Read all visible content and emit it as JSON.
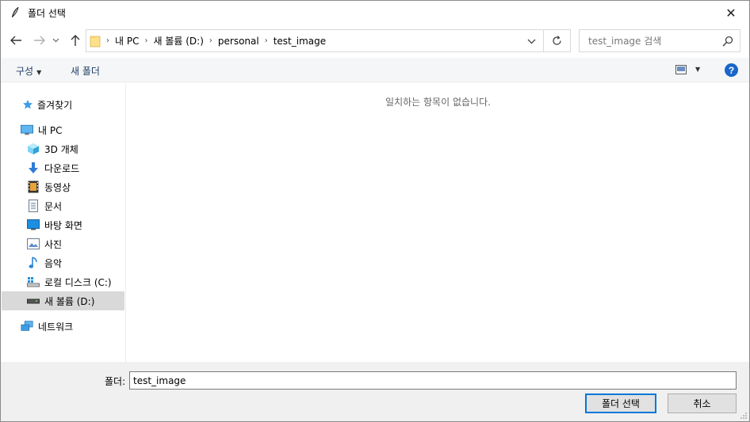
{
  "window": {
    "title": "폴더 선택",
    "close": "✕"
  },
  "nav": {
    "back": "←",
    "forward": "→",
    "recent": "⌄",
    "up": "↑",
    "breadcrumb": [
      "내 PC",
      "새 볼륨 (D:)",
      "personal",
      "test_image"
    ],
    "search_placeholder": "test_image 검색"
  },
  "toolbar": {
    "organize": "구성",
    "new_folder": "새 폴더",
    "help": "?"
  },
  "sidebar": {
    "quick_access": "즐겨찾기",
    "this_pc": "내 PC",
    "items": [
      {
        "label": "3D 개체",
        "icon": "cube-3d-icon"
      },
      {
        "label": "다운로드",
        "icon": "download-arrow-icon"
      },
      {
        "label": "동영상",
        "icon": "video-film-icon"
      },
      {
        "label": "문서",
        "icon": "document-icon"
      },
      {
        "label": "바탕 화면",
        "icon": "desktop-icon"
      },
      {
        "label": "사진",
        "icon": "picture-icon"
      },
      {
        "label": "음악",
        "icon": "music-note-icon"
      },
      {
        "label": "로컬 디스크 (C:)",
        "icon": "local-disk-icon"
      },
      {
        "label": "새 볼륨 (D:)",
        "icon": "drive-icon"
      }
    ],
    "network": "네트워크"
  },
  "content": {
    "empty_message": "일치하는 항목이 없습니다."
  },
  "bottom": {
    "folder_label": "폴더:",
    "folder_value": "test_image",
    "select_button": "폴더 선택",
    "cancel_button": "취소"
  },
  "colors": {
    "accent": "#0078d7",
    "selected_bg": "#d9d9d9",
    "footer_bg": "#f0f0f0"
  }
}
